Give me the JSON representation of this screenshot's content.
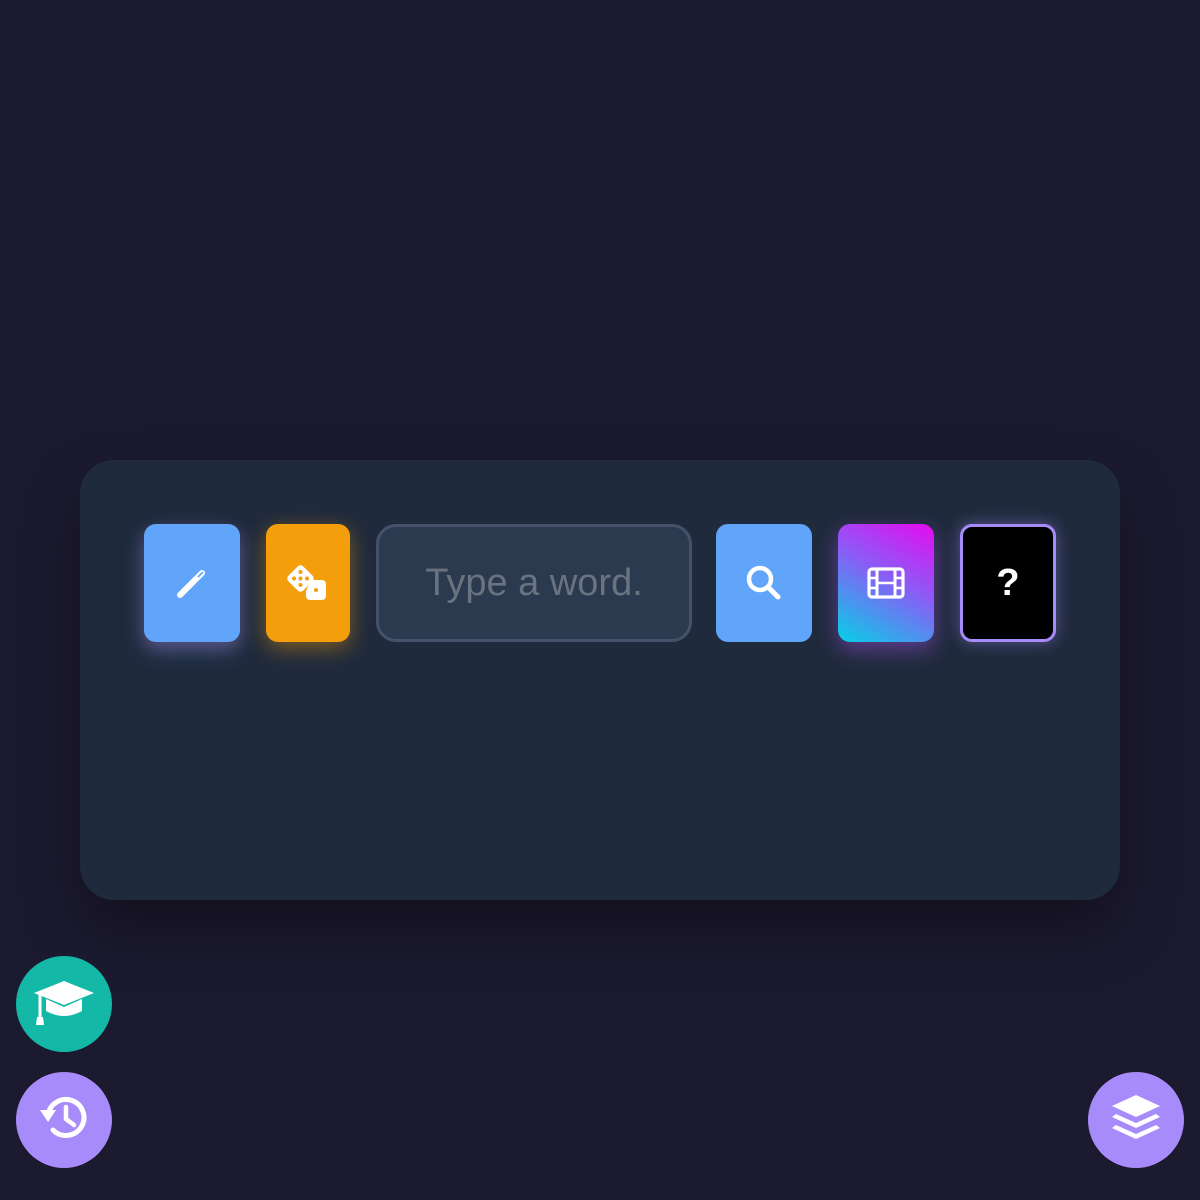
{
  "toolbar": {
    "search_placeholder": "Type a word.",
    "search_value": "",
    "help_label": "?"
  },
  "icons": {
    "wand": "magic-wand-icon",
    "dice": "dice-icon",
    "search": "magnifier-icon",
    "film": "film-icon",
    "learn": "graduation-cap-icon",
    "history": "history-icon",
    "layers": "layers-icon"
  },
  "colors": {
    "page_bg": "#1c1a2f",
    "card_bg": "#1f2a3c",
    "blue": "#60a5fa",
    "amber": "#f59e0b",
    "teal": "#14b8a6",
    "violet": "#a78bfa",
    "black": "#000000"
  }
}
